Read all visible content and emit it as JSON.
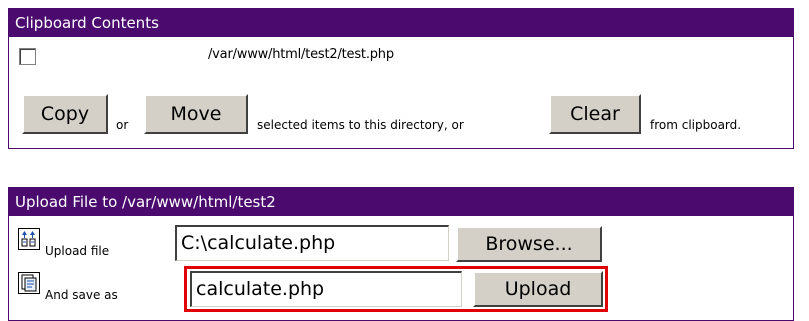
{
  "clipboard": {
    "title": "Clipboard Contents",
    "item_path": "/var/www/html/test2/test.php",
    "copy_label": "Copy",
    "or_text": "or",
    "move_label": "Move",
    "middle_text": "selected items to this directory, or",
    "clear_label": "Clear",
    "end_text": "from clipboard."
  },
  "upload": {
    "title": "Upload File to /var/www/html/test2",
    "upload_file_label": "Upload file",
    "file_value": "C:\\calculate.php",
    "browse_label": "Browse...",
    "save_as_label": "And save as",
    "save_as_value": "calculate.php",
    "upload_label": "Upload"
  },
  "colors": {
    "header_bg": "#4b0a6e",
    "highlight": "#e00000"
  }
}
